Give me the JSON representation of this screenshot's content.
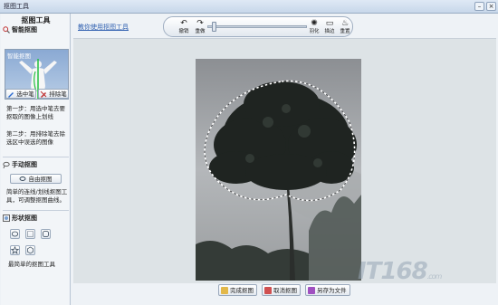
{
  "window": {
    "title": "抠图工具",
    "min_label": "–",
    "close_label": "×"
  },
  "sidebar": {
    "heading": "抠图工具",
    "smart": {
      "title": "智能抠图",
      "preview_label": "智能抠图",
      "select_btn": "选中笔",
      "exclude_btn": "排除笔",
      "step1": "第一步：用选中笔去要抠取的图像上划线",
      "step2": "第二步：用排除笔去除选区中误选的图像"
    },
    "manual": {
      "title": "手动抠图",
      "free_btn": "自由抠图",
      "desc": "简单的连线/划线抠图工具，可调整抠图曲线。"
    },
    "shape": {
      "title": "形状抠图",
      "desc": "最简单的抠图工具"
    }
  },
  "main": {
    "help_link": "教你使用抠图工具",
    "toolbar": {
      "undo": "撤销",
      "redo": "重做",
      "feather": "羽化",
      "edge": "描边",
      "reset": "重置"
    },
    "slider_value": 0.05,
    "buttons": {
      "finish": "完成抠图",
      "cancel": "取消抠图",
      "save_as": "另存为文件"
    },
    "watermark": {
      "text": "IT168",
      "suffix": ".com"
    }
  },
  "colors": {
    "accent": "#3060b0",
    "selection": "#ffffff"
  }
}
